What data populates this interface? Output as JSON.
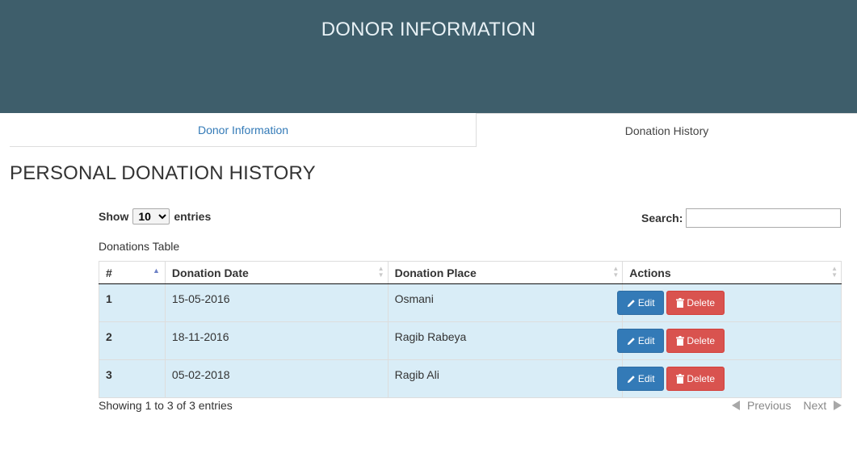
{
  "header": {
    "title": "DONOR INFORMATION"
  },
  "tabs": [
    {
      "label": "Donor Information",
      "active": false
    },
    {
      "label": "Donation History",
      "active": true
    }
  ],
  "page": {
    "heading": "PERSONAL DONATION HISTORY"
  },
  "table_controls": {
    "show_label": "Show",
    "entries_label": "entries",
    "page_size": "10",
    "search_label": "Search:",
    "search_value": "",
    "caption": "Donations Table"
  },
  "table": {
    "columns": [
      "#",
      "Donation Date",
      "Donation Place",
      "Actions"
    ],
    "sorted_column": "#",
    "sort_direction": "ascending",
    "rows": [
      {
        "num": "1",
        "date": "15-05-2016",
        "place": "Osmani"
      },
      {
        "num": "2",
        "date": "18-11-2016",
        "place": "Ragib Rabeya"
      },
      {
        "num": "3",
        "date": "05-02-2018",
        "place": "Ragib Ali"
      }
    ],
    "edit_label": "Edit",
    "delete_label": "Delete"
  },
  "footer": {
    "info": "Showing 1 to 3 of 3 entries",
    "previous_label": "Previous",
    "next_label": "Next"
  },
  "colors": {
    "banner": "#3e5e6b",
    "row_highlight": "#d9edf7",
    "edit_button": "#337ab7",
    "delete_button": "#d9534f",
    "link": "#337ab7"
  }
}
